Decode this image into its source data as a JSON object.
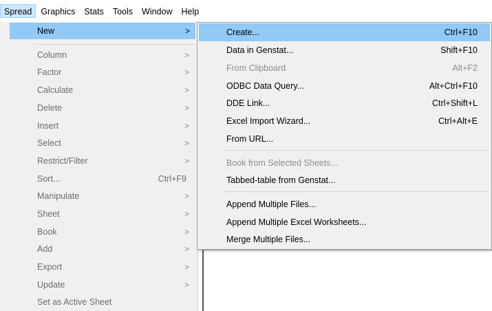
{
  "menubar": {
    "items": [
      {
        "label": "Spread"
      },
      {
        "label": "Graphics"
      },
      {
        "label": "Stats"
      },
      {
        "label": "Tools"
      },
      {
        "label": "Window"
      },
      {
        "label": "Help"
      }
    ]
  },
  "spread_menu": {
    "items": [
      {
        "label": "New",
        "arrow": ">"
      },
      {
        "label": "Column",
        "arrow": ">"
      },
      {
        "label": "Factor",
        "arrow": ">"
      },
      {
        "label": "Calculate",
        "arrow": ">"
      },
      {
        "label": "Delete",
        "arrow": ">"
      },
      {
        "label": "Insert",
        "arrow": ">"
      },
      {
        "label": "Select",
        "arrow": ">"
      },
      {
        "label": "Restrict/Filter",
        "arrow": ">"
      },
      {
        "label": "Sort...",
        "shortcut": "Ctrl+F9"
      },
      {
        "label": "Manipulate",
        "arrow": ">"
      },
      {
        "label": "Sheet",
        "arrow": ">"
      },
      {
        "label": "Book",
        "arrow": ">"
      },
      {
        "label": "Add",
        "arrow": ">"
      },
      {
        "label": "Export",
        "arrow": ">"
      },
      {
        "label": "Update",
        "arrow": ">"
      },
      {
        "label": "Set as Active Sheet"
      }
    ]
  },
  "new_submenu": {
    "items": [
      {
        "label": "Create...",
        "shortcut": "Ctrl+F10"
      },
      {
        "label": "Data in Genstat...",
        "shortcut": "Shift+F10"
      },
      {
        "label": "From Clipboard",
        "shortcut": "Alt+F2"
      },
      {
        "label": "ODBC Data Query...",
        "shortcut": "Alt+Ctrl+F10"
      },
      {
        "label": "DDE Link...",
        "shortcut": "Ctrl+Shift+L"
      },
      {
        "label": "Excel Import Wizard...",
        "shortcut": "Ctrl+Alt+E"
      },
      {
        "label": "From URL..."
      },
      {
        "label": "Book from Selected Sheets..."
      },
      {
        "label": "Tabbed-table from Genstat..."
      },
      {
        "label": "Append Multiple Files..."
      },
      {
        "label": "Append Multiple Excel Worksheets..."
      },
      {
        "label": "Merge Multiple Files..."
      }
    ]
  },
  "colors": {
    "menu_background": "#f0f0f0",
    "highlight": "#91c9f7",
    "menubar_active": "#cce8ff",
    "disabled_text": "#6d6d6d"
  }
}
